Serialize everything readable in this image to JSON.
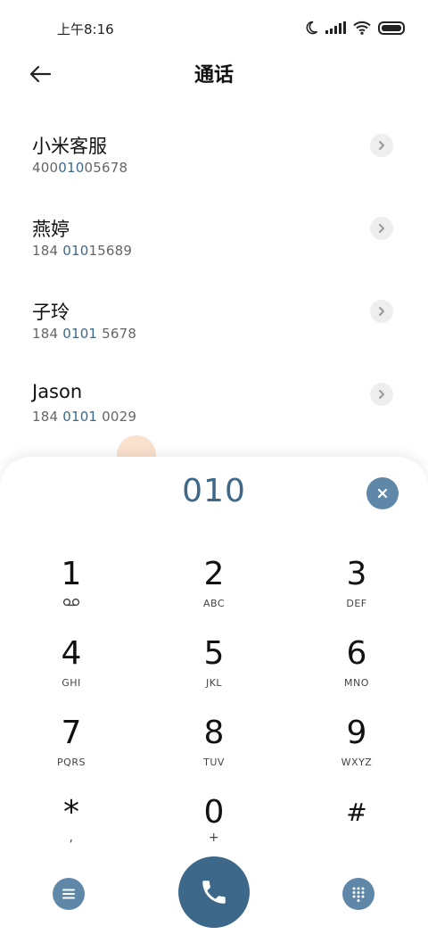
{
  "status_bar": {
    "time": "上午8:16"
  },
  "header": {
    "title": "通话"
  },
  "results": [
    {
      "name": "小米客服",
      "num_pre": "400",
      "num_hl": "010",
      "num_post": "05678"
    },
    {
      "name": "燕婷",
      "num_pre": "184 ",
      "num_hl": "010",
      "num_post": "15689"
    },
    {
      "name": "子玲",
      "num_pre": "184 ",
      "num_hl": "0101",
      "num_post": " 5678"
    },
    {
      "name": "Jason",
      "num_pre": "184 ",
      "num_hl": "0101",
      "num_post": " 0029"
    }
  ],
  "dialpad": {
    "entered": "010",
    "keys": [
      {
        "digit": "1",
        "letters": ""
      },
      {
        "digit": "2",
        "letters": "ABC"
      },
      {
        "digit": "3",
        "letters": "DEF"
      },
      {
        "digit": "4",
        "letters": "GHI"
      },
      {
        "digit": "5",
        "letters": "JKL"
      },
      {
        "digit": "6",
        "letters": "MNO"
      },
      {
        "digit": "7",
        "letters": "PQRS"
      },
      {
        "digit": "8",
        "letters": "TUV"
      },
      {
        "digit": "9",
        "letters": "WXYZ"
      },
      {
        "digit": "*",
        "letters": ","
      },
      {
        "digit": "0",
        "letters": "+"
      },
      {
        "digit": "#",
        "letters": ""
      }
    ]
  },
  "colors": {
    "accent": "#3d6889",
    "accent_light": "#5e87a8"
  },
  "icons": {
    "voicemail": "voicemail-icon",
    "menu": "menu-icon",
    "call": "phone-icon",
    "keypad": "keypad-icon",
    "clear": "close-icon",
    "back": "arrow-left-icon"
  }
}
